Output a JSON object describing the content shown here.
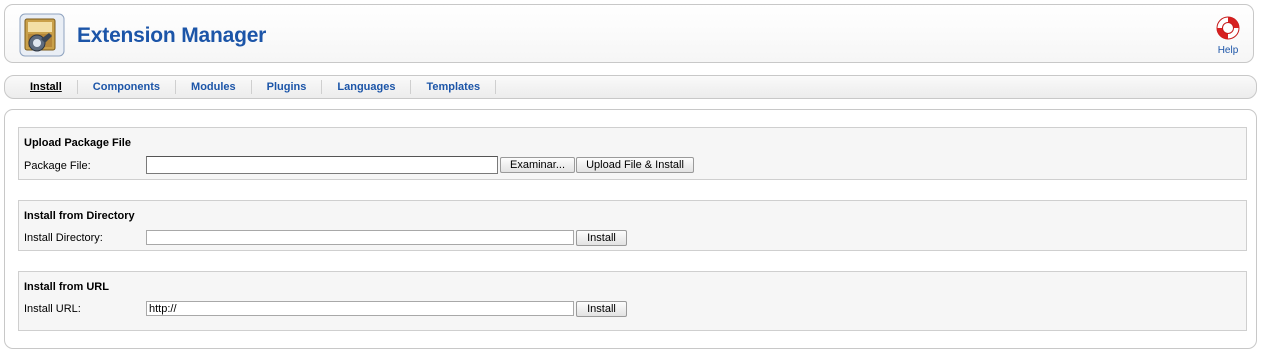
{
  "header": {
    "title": "Extension Manager",
    "app_icon": "extension-box-icon",
    "help_icon": "lifebuoy-icon",
    "help_label": "Help"
  },
  "submenu": {
    "items": [
      {
        "label": "Install",
        "active": true
      },
      {
        "label": "Components",
        "active": false
      },
      {
        "label": "Modules",
        "active": false
      },
      {
        "label": "Plugins",
        "active": false
      },
      {
        "label": "Languages",
        "active": false
      },
      {
        "label": "Templates",
        "active": false
      }
    ]
  },
  "upload_package": {
    "title": "Upload Package File",
    "field_label": "Package File:",
    "value": "",
    "browse_label": "Examinar...",
    "submit_label": "Upload File & Install"
  },
  "install_directory": {
    "title": "Install from Directory",
    "field_label": "Install Directory:",
    "value": "",
    "submit_label": "Install"
  },
  "install_url": {
    "title": "Install from URL",
    "field_label": "Install URL:",
    "value": "http://",
    "submit_label": "Install"
  },
  "colors": {
    "accent": "#1c55a8",
    "panel_bg": "#f6f6f6",
    "border": "#c8c8c8"
  }
}
